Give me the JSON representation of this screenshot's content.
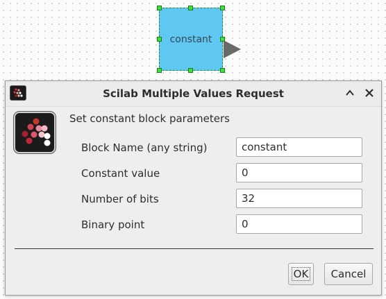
{
  "canvas": {
    "block_label": "constant"
  },
  "dialog": {
    "title": "Scilab Multiple Values Request",
    "heading": "Set constant block parameters",
    "fields": [
      {
        "label": "Block Name (any string)",
        "value": "constant"
      },
      {
        "label": "Constant value",
        "value": "0"
      },
      {
        "label": "Number of bits",
        "value": "32"
      },
      {
        "label": "Binary point",
        "value": "0"
      }
    ],
    "ok_label": "OK",
    "cancel_label": "Cancel",
    "icons": {
      "app": "scilab-icon",
      "minimize": "chevron-up-icon",
      "close": "close-icon"
    }
  }
}
